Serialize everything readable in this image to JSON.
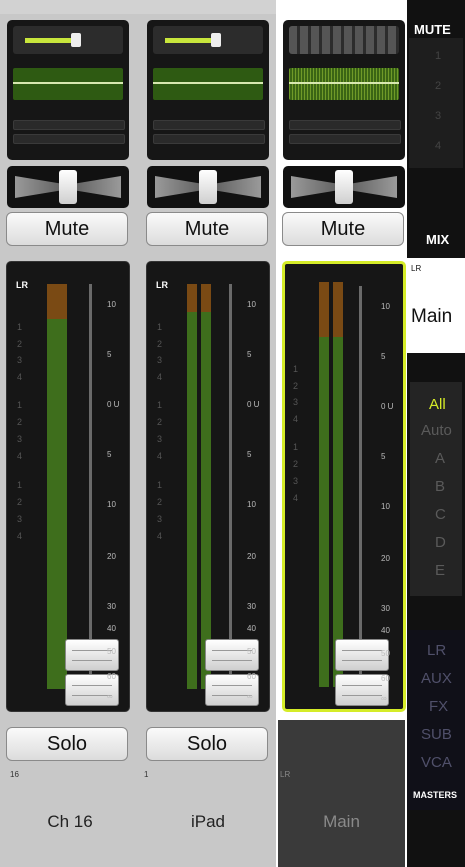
{
  "strips": [
    {
      "id": "ch16",
      "mute_label": "Mute",
      "solo_label": "Solo",
      "name": "Ch 16",
      "number": "16",
      "meter_tag": "LR",
      "selected": false
    },
    {
      "id": "ipad",
      "mute_label": "Mute",
      "solo_label": "Solo",
      "name": "iPad",
      "number": "1",
      "meter_tag": "LR",
      "selected": false
    },
    {
      "id": "main",
      "mute_label": "Mute",
      "solo_label": "",
      "name": "Main",
      "number": "LR",
      "meter_tag": "",
      "selected": true
    }
  ],
  "channel_labels": [
    "1",
    "2",
    "3",
    "4",
    "1",
    "2",
    "3",
    "4",
    "1",
    "2",
    "3",
    "4"
  ],
  "main_labels": [
    "1",
    "2",
    "3",
    "4",
    "1",
    "2",
    "3",
    "4"
  ],
  "scale_labels": [
    "10",
    "5",
    "0 U",
    "5",
    "10",
    "20",
    "30",
    "40",
    "50",
    "60",
    "∞"
  ],
  "sidebar": {
    "mute_header": "MUTE",
    "mute_groups": [
      "1",
      "2",
      "3",
      "4"
    ],
    "mix_header": "MIX",
    "mix_tag": "LR",
    "mix_name": "Main",
    "filters": [
      "All",
      "Auto",
      "A",
      "B",
      "C",
      "D",
      "E"
    ],
    "views": [
      "LR",
      "AUX",
      "FX",
      "SUB",
      "VCA"
    ],
    "masters_label": "MASTERS"
  },
  "colors": {
    "accent": "#d5ec28",
    "meter_green": "#3e6e1c",
    "meter_orange": "#7a4a14",
    "sidebar_bg": "#111111"
  }
}
